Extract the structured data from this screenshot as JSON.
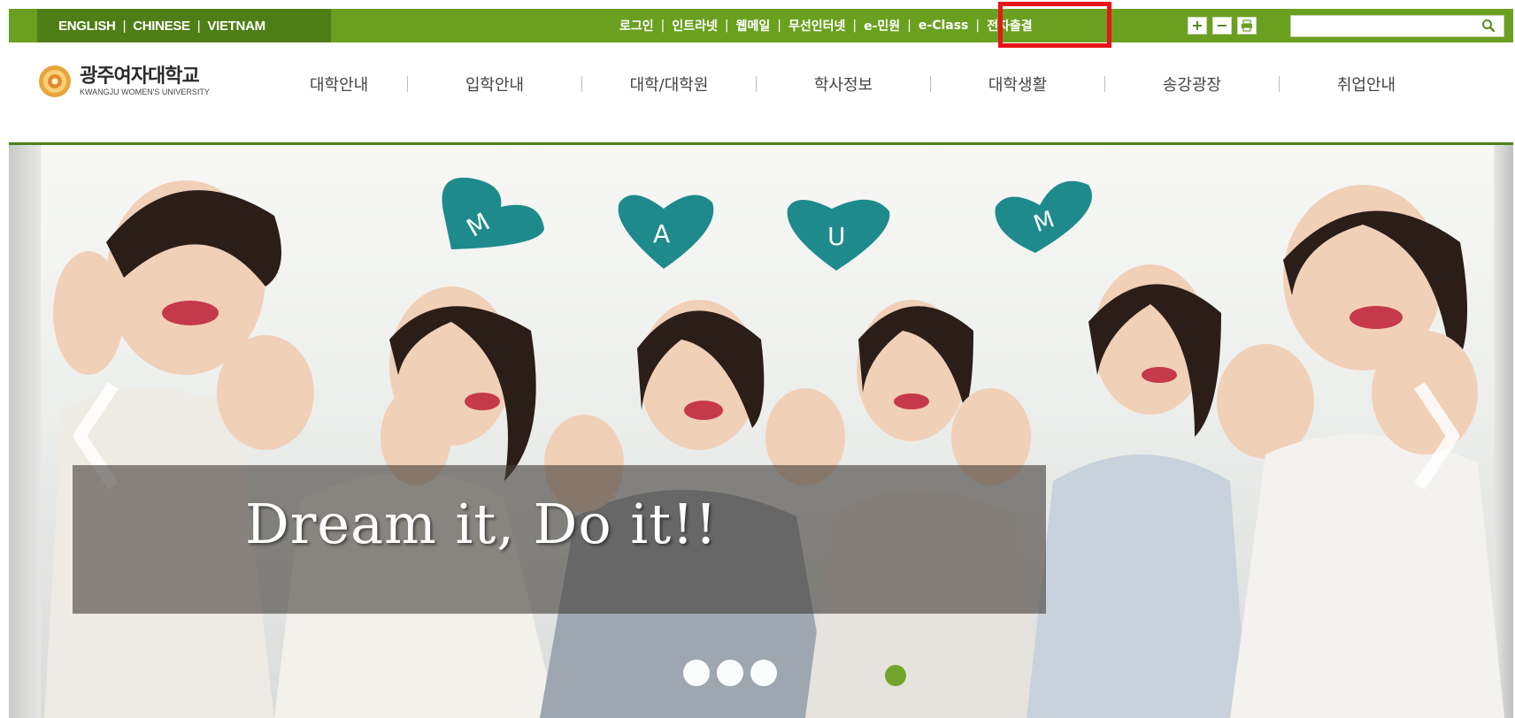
{
  "topbar": {
    "languages": [
      "ENGLISH",
      "CHINESE",
      "VIETNAM"
    ],
    "utility_links": [
      "로그인",
      "인트라넷",
      "웹메일",
      "무선인터넷",
      "e-민원",
      "e-Class",
      "전자출결"
    ],
    "zoom_in": "+",
    "zoom_out": "−",
    "search_placeholder": "",
    "separator": "|"
  },
  "logo": {
    "korean": "광주여자대학교",
    "english": "KWANGJU WOMEN'S UNIVERSITY"
  },
  "nav": [
    "대학안내",
    "입학안내",
    "대학/대학원",
    "학사정보",
    "대학생활",
    "송강광장",
    "취업안내"
  ],
  "hero": {
    "caption": "Dream it, Do it!!",
    "heart_letters": [
      "M",
      "A",
      "U",
      "M"
    ],
    "slides_total": 4,
    "active_slide": 4
  },
  "colors": {
    "brand_green": "#6aa020",
    "dark_green": "#4e7f16",
    "heart_teal": "#1f8a8c",
    "highlight_red": "#e8141a"
  }
}
